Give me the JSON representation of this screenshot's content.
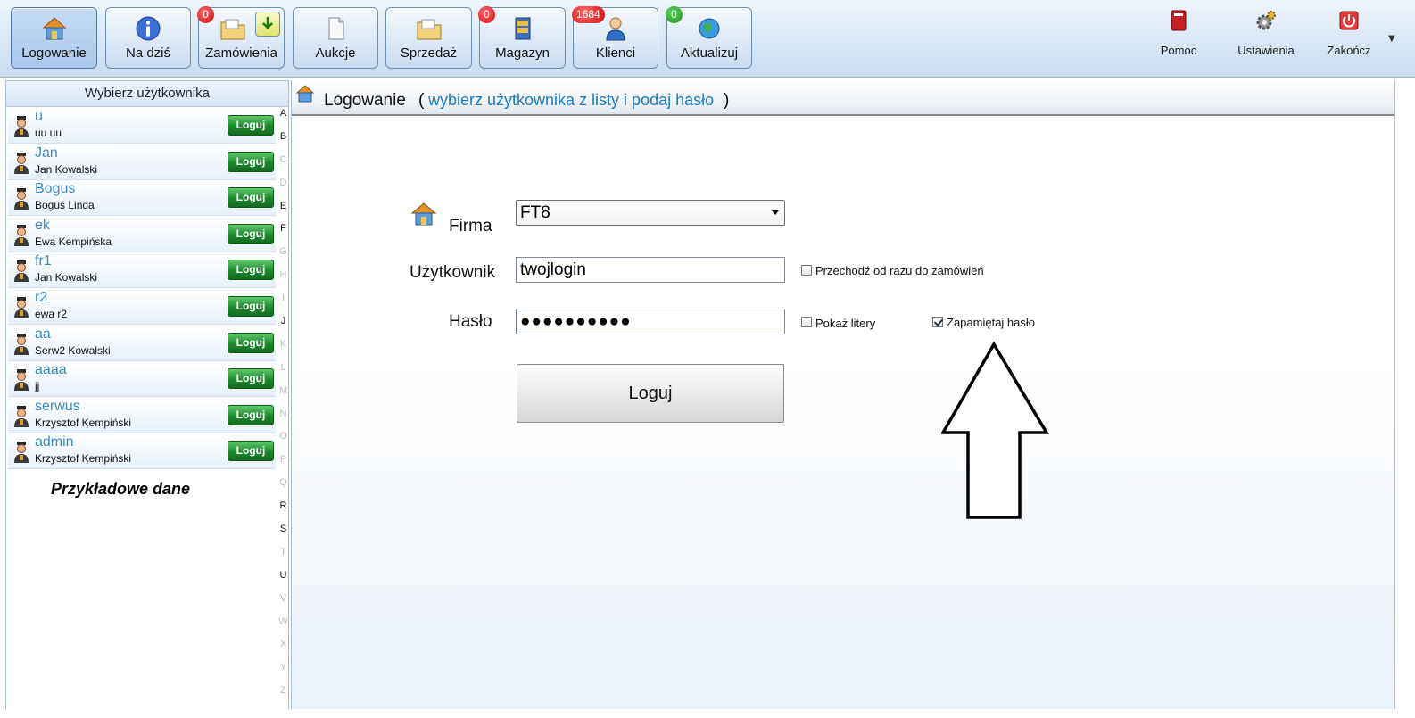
{
  "toolbar": {
    "buttons": [
      {
        "label": "Logowanie"
      },
      {
        "label": "Na dziś"
      },
      {
        "label": "Zamówienia",
        "badge": "0"
      },
      {
        "label": "Aukcje"
      },
      {
        "label": "Sprzedaż"
      },
      {
        "label": "Magazyn",
        "badge": "0"
      },
      {
        "label": "Klienci",
        "badge": "1684"
      },
      {
        "label": "Aktualizuj",
        "badge": "0"
      }
    ],
    "right": [
      {
        "label": "Pomoc"
      },
      {
        "label": "Ustawienia"
      },
      {
        "label": "Zakończ"
      }
    ]
  },
  "left": {
    "header": "Wybierz użytkownika",
    "login_btn": "Loguj",
    "note": "Przykładowe dane",
    "users": [
      {
        "login": "u",
        "name": "uu uu"
      },
      {
        "login": "Jan",
        "name": "Jan Kowalski"
      },
      {
        "login": "Bogus",
        "name": "Boguś Linda"
      },
      {
        "login": "ek",
        "name": "Ewa Kempińska"
      },
      {
        "login": "fr1",
        "name": "Jan Kowalski"
      },
      {
        "login": "r2",
        "name": "ewa r2"
      },
      {
        "login": "aa",
        "name": "Serw2 Kowalski"
      },
      {
        "login": "aaaa",
        "name": "jj"
      },
      {
        "login": "serwus",
        "name": "Krzysztof Kempiński"
      },
      {
        "login": "admin",
        "name": "Krzysztof Kempiński"
      }
    ],
    "alphabet": [
      "A",
      "B",
      "C",
      "D",
      "E",
      "F",
      "G",
      "H",
      "I",
      "J",
      "K",
      "L",
      "M",
      "N",
      "O",
      "P",
      "Q",
      "R",
      "S",
      "T",
      "U",
      "V",
      "W",
      "X",
      "Y",
      "Z"
    ],
    "alphabet_active": [
      "A",
      "B",
      "E",
      "F",
      "J",
      "R",
      "S",
      "U"
    ]
  },
  "main": {
    "title": "Logowanie",
    "paren_open": "(",
    "hint": "wybierz użytkownika z listy i podaj hasło",
    "paren_close": ")",
    "firma_label": "Firma",
    "firma_value": "FT8",
    "user_label": "Użytkownik",
    "user_value": "twojlogin",
    "pass_label": "Hasło",
    "pass_value": "●●●●●●●●●●",
    "chk_orders": "Przechodź od razu do zamówień",
    "chk_show": "Pokaż litery",
    "chk_remember": "Zapamiętaj hasło",
    "login_button": "Loguj"
  }
}
